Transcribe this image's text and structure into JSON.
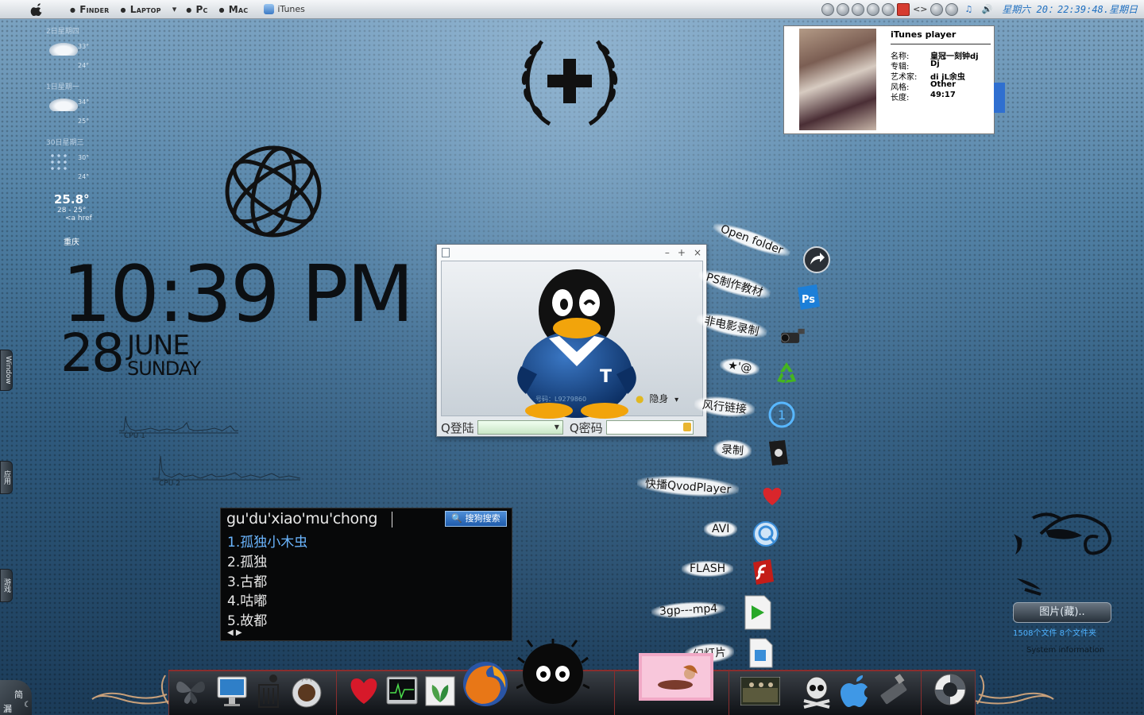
{
  "menubar": {
    "items": [
      "Finder",
      "Laptop",
      "Pc",
      "Mac"
    ],
    "laptop_arrow": "▾",
    "app_title": "iTunes",
    "tray_clock": "星期六 20：22:39:48.星期日"
  },
  "weather": {
    "days": [
      {
        "date": "2日星期四",
        "hi": "33°",
        "lo": "24°"
      },
      {
        "date": "1日星期一",
        "hi": "34°",
        "lo": "25°"
      },
      {
        "date": "30日星期三",
        "hi": "30°",
        "lo": "24°"
      }
    ],
    "current_temp": "25.8°",
    "range": "28 - 25°",
    "href_text": "<a href",
    "city": "重庆"
  },
  "clock": {
    "time": "10:39 PM",
    "day": "28",
    "month": "JUNE",
    "weekday": "SUNDAY"
  },
  "side_tabs": {
    "window": "Window",
    "apps": "应用",
    "games": "游戏"
  },
  "cpu": {
    "label1": "CPU 1",
    "label2": "CPU 2"
  },
  "itunes_widget": {
    "title": "iTunes player",
    "fields": [
      {
        "key": "名称:",
        "value": "皇冠一刻钟dj"
      },
      {
        "key": "专辑:",
        "value": "Dj"
      },
      {
        "key": "艺术家:",
        "value": "di jL余虫"
      },
      {
        "key": "风格:",
        "value": "Other"
      },
      {
        "key": "长度:",
        "value": "49:17"
      }
    ]
  },
  "qq_window": {
    "minimize": "–",
    "maximize": "+",
    "close": "×",
    "hide_label": "隐身",
    "hide_arrow": "▾",
    "login_label": "Q登陆",
    "password_label": "Q密码",
    "number_watermark": "号码：L9279860"
  },
  "ime": {
    "pinyin": "gu'du'xiao'mu'chong",
    "search_button": "搜狗搜索",
    "candidates": [
      "1.孤独小木虫",
      "2.孤独",
      "3.古都",
      "4.咕嘟",
      "5.故都"
    ],
    "arrows": "◀ ▶"
  },
  "launcher": {
    "items": [
      {
        "label": "Open folder",
        "icon": "arrow-curve-icon"
      },
      {
        "label": "PS制作教材",
        "icon": "photoshop-icon"
      },
      {
        "label": "非电影录制",
        "icon": "camcorder-icon"
      },
      {
        "label": "★'@",
        "icon": "recycle-icon"
      },
      {
        "label": "风行链接",
        "icon": "funshion-icon"
      },
      {
        "label": "录制",
        "icon": "apple-box-icon"
      },
      {
        "label": "快播QvodPlayer",
        "icon": "heart-icon"
      },
      {
        "label": "AVI",
        "icon": "quicktime-icon"
      },
      {
        "label": "FLASH",
        "icon": "flash-icon"
      },
      {
        "label": "3gp---mp4",
        "icon": "media-play-icon"
      },
      {
        "label": "幻灯片",
        "icon": "audio-file-icon"
      }
    ]
  },
  "right_widgets": {
    "folder_title": "图片(藏)..",
    "folder_info": "1508个文件 8个文件夹",
    "sysinfo_title": "System information"
  },
  "dock": {
    "icons": [
      "butterfly-icon",
      "imac-icon",
      "trash-icon",
      "coffee-icon",
      "heart-icon",
      "activity-monitor-icon",
      "photo-leaf-icon",
      "firefox-icon",
      "soot-sprite-icon",
      "pinup-photo-icon",
      "video-thumb-icon",
      "skull-icon",
      "apple-logo-icon",
      "usb-drive-icon",
      "lifebuoy-icon"
    ]
  },
  "corner_tab": {
    "label_top": "简",
    "label_bottom": "漏"
  },
  "colors": {
    "accent_blue": "#2070c0",
    "ime_highlight": "#6bb6ff",
    "folder_info_blue": "#4fb2ff",
    "dock_border": "#8a2e2e"
  }
}
